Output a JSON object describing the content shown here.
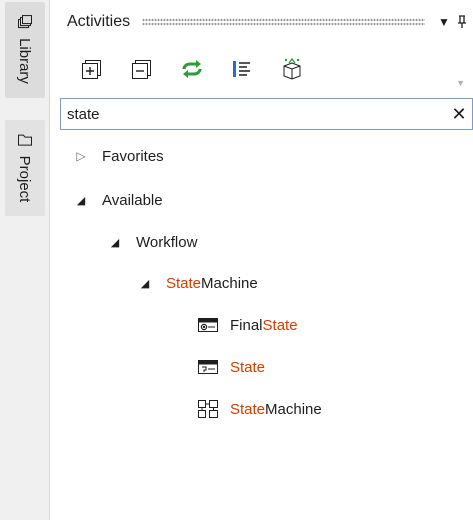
{
  "sidebar": {
    "tabs": [
      {
        "label": "Library",
        "icon": "library-icon"
      },
      {
        "label": "Project",
        "icon": "project-icon"
      }
    ]
  },
  "panel": {
    "title": "Activities",
    "dropdown_glyph": "▼",
    "pin_glyph": "ꟼ"
  },
  "toolbar": {
    "buttons": [
      {
        "name": "expand-all-button",
        "icon": "expand-all-icon"
      },
      {
        "name": "collapse-all-button",
        "icon": "collapse-all-icon"
      },
      {
        "name": "refresh-button",
        "icon": "refresh-icon"
      },
      {
        "name": "filter-button",
        "icon": "list-filter-icon"
      },
      {
        "name": "package-button",
        "icon": "package-icon"
      }
    ]
  },
  "search": {
    "value": "state",
    "clear_glyph": "✕"
  },
  "tree": {
    "favorites": {
      "label": "Favorites",
      "expanded": false
    },
    "available": {
      "label": "Available",
      "expanded": true
    },
    "workflow": {
      "label": "Workflow",
      "expanded": true
    },
    "state_machine": {
      "match": "State",
      "rest": " Machine",
      "expanded": true
    },
    "items": [
      {
        "prefix": "Final ",
        "match": "State",
        "suffix": "",
        "icon": "final-state-icon"
      },
      {
        "prefix": "",
        "match": "State",
        "suffix": "",
        "icon": "state-icon"
      },
      {
        "prefix": "",
        "match": "State",
        "suffix": " Machine",
        "icon": "state-machine-icon"
      }
    ]
  },
  "colors": {
    "match_highlight": "#d83b01",
    "refresh_green": "#2e9b3a",
    "accent_blue": "#2b6cc4"
  }
}
